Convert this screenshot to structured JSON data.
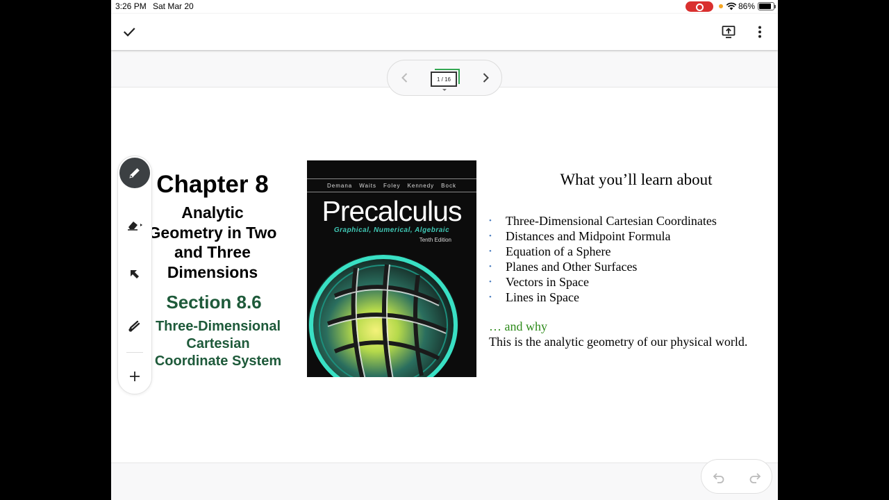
{
  "status_bar": {
    "time": "3:26 PM",
    "date": "Sat Mar 20",
    "battery": "86%"
  },
  "top_bar": {
    "done_icon": "checkmark-icon",
    "present_icon": "present-upload-icon",
    "more_icon": "more-vertical-icon"
  },
  "page_nav": {
    "indicator": "1 / 16",
    "prev_icon": "chevron-left-icon",
    "next_icon": "chevron-right-icon"
  },
  "slide": {
    "chapter": "Chapter 8",
    "chapter_subtitle_lines": [
      "Analytic",
      "Geometry in Two",
      "and Three",
      "Dimensions"
    ],
    "section_number": "Section 8.6",
    "section_title_lines": [
      "Three-Dimensional",
      "Cartesian",
      "Coordinate System"
    ],
    "book": {
      "authors": [
        "Demana",
        "Waits",
        "Foley",
        "Kennedy",
        "Bock"
      ],
      "title": "Precalculus",
      "subtitle": "Graphical, Numerical, Algebraic",
      "edition": "Tenth Edition"
    },
    "learn_heading": "What you’ll learn about",
    "topics": [
      "Three-Dimensional Cartesian Coordinates",
      "Distances and Midpoint Formula",
      "Equation of a Sphere",
      "Planes and Other Surfaces",
      "Vectors in Space",
      "Lines in Space"
    ],
    "why_label": "… and why",
    "why_text": "This is the analytic geometry of our physical world."
  },
  "tools": [
    "pen-icon",
    "eraser-icon",
    "select-arrow-icon",
    "laser-pointer-icon",
    "add-icon"
  ],
  "colors": {
    "section_green": "#1e5a3a",
    "why_green": "#2d8a1a",
    "bullet_blue": "#4a7dbf",
    "thumb_green": "#34a853",
    "pen_active": "#3c4043"
  }
}
